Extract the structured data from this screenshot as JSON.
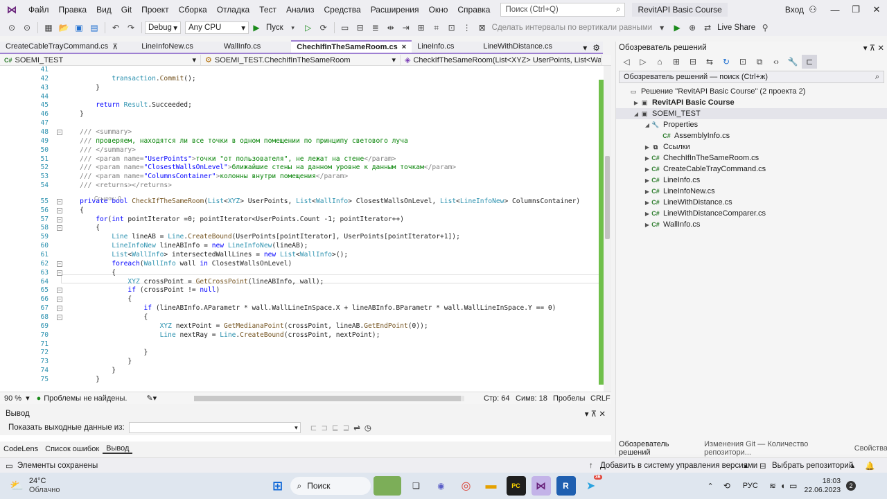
{
  "menu": {
    "items": [
      "Файл",
      "Правка",
      "Вид",
      "Git",
      "Проект",
      "Сборка",
      "Отладка",
      "Тест",
      "Анализ",
      "Средства",
      "Расширения",
      "Окно",
      "Справка"
    ],
    "search_placeholder": "Поиск (Ctrl+Q)",
    "project_name": "RevitAPI Basic Course",
    "login": "Вход"
  },
  "toolbar": {
    "config": "Debug",
    "platform": "Any CPU",
    "run_label": "Пуск",
    "align_label": "Сделать интервалы по вертикали равными",
    "live_share": "Live Share"
  },
  "tabs": [
    {
      "label": "CreateCableTrayCommand.cs",
      "pinned": true,
      "active": false
    },
    {
      "label": "LineInfoNew.cs",
      "active": false
    },
    {
      "label": "WallInfo.cs",
      "active": false
    },
    {
      "label": "ChechIfInTheSameRoom.cs",
      "active": true,
      "close": "×"
    },
    {
      "label": "LineInfo.cs",
      "active": false
    },
    {
      "label": "LineWithDistance.cs",
      "active": false
    }
  ],
  "navbar": {
    "project": "SOEMI_TEST",
    "class": "SOEMI_TEST.ChechIfInTheSameRoom",
    "member": "CheckIfTheSameRoom(List<XYZ> UserPoints, List<WallInfo"
  },
  "code": {
    "references": "Ссылок: 0",
    "lines": [
      {
        "n": "41",
        "html": ""
      },
      {
        "n": "42",
        "html": "            <span class='ty'>transaction</span>.<span class='mt'>Commit</span>();"
      },
      {
        "n": "43",
        "html": "        }"
      },
      {
        "n": "44",
        "html": ""
      },
      {
        "n": "45",
        "html": "        <span class='kw'>return</span> <span class='ty'>Result</span>.Succeeded;"
      },
      {
        "n": "46",
        "html": "    }"
      },
      {
        "n": "47",
        "html": ""
      },
      {
        "n": "48",
        "html": "    <span class='cmx'>///</span> <span class='cmx'>&lt;summary&gt;</span>"
      },
      {
        "n": "49",
        "html": "    <span class='cmx'>///</span> <span class='cm'>проверяем, находятся ли все точки в одном помещении по принципу светового луча</span>"
      },
      {
        "n": "50",
        "html": "    <span class='cmx'>/// &lt;/summary&gt;</span>"
      },
      {
        "n": "51",
        "html": "    <span class='cmx'>/// &lt;param name=</span><span class='kw'>\"UserPoints\"</span><span class='cmx'>&gt;</span><span class='cm'>точки \"от пользователя\", не лежат на стене</span><span class='cmx'>&lt;/param&gt;</span>"
      },
      {
        "n": "52",
        "html": "    <span class='cmx'>/// &lt;param name=</span><span class='kw'>\"ClosestWallsOnLevel\"</span><span class='cmx'>&gt;</span><span class='cm'>ближайшие стены на данном уровне к данным точкам</span><span class='cmx'>&lt;/param&gt;</span>"
      },
      {
        "n": "53",
        "html": "    <span class='cmx'>/// &lt;param name=</span><span class='kw'>\"ColumnsContainer\"</span><span class='cmx'>&gt;</span><span class='cm'>колонны внутри помещения</span><span class='cmx'>&lt;/param&gt;</span>"
      },
      {
        "n": "54",
        "html": "    <span class='cmx'>/// &lt;returns&gt;&lt;/returns&gt;</span>"
      },
      {
        "n": "55",
        "html": "    <span class='kw'>private</span> <span class='kw'>bool</span> <span class='mt'>CheckIfTheSameRoom</span>(<span class='ty'>List</span>&lt;<span class='ty'>XYZ</span>&gt; UserPoints, <span class='ty'>List</span>&lt;<span class='ty'>WallInfo</span>&gt; ClosestWallsOnLevel, <span class='ty'>List</span>&lt;<span class='ty'>LineInfoNew</span>&gt; ColumnsContainer)"
      },
      {
        "n": "56",
        "html": "    {"
      },
      {
        "n": "57",
        "html": "        <span class='kw'>for</span>(<span class='kw'>int</span> pointIterator =0; pointIterator&lt;UserPoints.Count -1; pointIterator++)"
      },
      {
        "n": "58",
        "html": "        {"
      },
      {
        "n": "59",
        "html": "            <span class='ty'>Line</span> lineAB = <span class='ty'>Line</span>.<span class='mt'>CreateBound</span>(UserPoints[pointIterator], UserPoints[pointIterator+1]);"
      },
      {
        "n": "60",
        "html": "            <span class='ty'>LineInfoNew</span> lineABInfo = <span class='kw'>new</span> <span class='ty'>LineInfoNew</span>(lineAB);"
      },
      {
        "n": "61",
        "html": "            <span class='ty'>List</span>&lt;<span class='ty'>WallInfo</span>&gt; intersectedWallLines = <span class='kw'>new</span> <span class='ty'>List</span>&lt;<span class='ty'>WallInfo</span>&gt;();"
      },
      {
        "n": "62",
        "html": "            <span class='kw'>foreach</span>(<span class='ty'>WallInfo</span> wall <span class='kw'>in</span> ClosestWallsOnLevel)"
      },
      {
        "n": "63",
        "html": "            {"
      },
      {
        "n": "64",
        "html": "                <span class='ty'>XYZ</span> crossPoint = <span class='mt'>GetCrossPoint</span>(lineABInfo, wall);"
      },
      {
        "n": "65",
        "html": "                <span class='kw'>if</span> (crossPoint != <span class='kw'>null</span>)"
      },
      {
        "n": "66",
        "html": "                {"
      },
      {
        "n": "67",
        "html": "                    <span class='kw'>if</span> (lineABInfo.AParametr * wall.WallLineInSpace.X + lineABInfo.BParametr * wall.WallLineInSpace.Y == 0)"
      },
      {
        "n": "68",
        "html": "                    {"
      },
      {
        "n": "69",
        "html": "                        <span class='ty'>XYZ</span> nextPoint = <span class='mt'>GetMedianaPoint</span>(crossPoint, lineAB.<span class='mt'>GetEndPoint</span>(0));"
      },
      {
        "n": "70",
        "html": "                        <span class='ty'>Line</span> nextRay = <span class='ty'>Line</span>.<span class='mt'>CreateBound</span>(crossPoint, nextPoint);"
      },
      {
        "n": "71",
        "html": ""
      },
      {
        "n": "72",
        "html": "                    }"
      },
      {
        "n": "73",
        "html": "                }"
      },
      {
        "n": "74",
        "html": "            }"
      },
      {
        "n": "75",
        "html": "        }"
      }
    ]
  },
  "editor_status": {
    "zoom": "90 %",
    "problems": "Проблемы не найдены.",
    "line": "Стр: 64",
    "col": "Симв: 18",
    "tabs": "Пробелы",
    "eol": "CRLF"
  },
  "output": {
    "title": "Вывод",
    "show_from": "Показать выходные данные из:",
    "bottom_tabs": [
      "CodeLens",
      "Список ошибок",
      "Вывод"
    ]
  },
  "solution_explorer": {
    "title": "Обозреватель решений",
    "search": "Обозреватель решений — поиск (Ctrl+ж)",
    "tree": [
      {
        "indent": 0,
        "tri": "",
        "icon": "▭",
        "label": "Решение \"RevitAPI Basic Course\"  (2 проекта 2)",
        "bold": false
      },
      {
        "indent": 1,
        "tri": "▶",
        "icon": "▣",
        "label": "RevitAPI Basic Course",
        "bold": true
      },
      {
        "indent": 1,
        "tri": "◢",
        "icon": "▣",
        "label": "SOEMI_TEST",
        "bold": false,
        "sel": true
      },
      {
        "indent": 2,
        "tri": "◢",
        "icon": "🔧",
        "label": "Properties",
        "bold": false
      },
      {
        "indent": 3,
        "tri": "",
        "icon": "C#",
        "label": "AssemblyInfo.cs",
        "bold": false
      },
      {
        "indent": 2,
        "tri": "▶",
        "icon": "⧉",
        "label": "Ссылки",
        "bold": false
      },
      {
        "indent": 2,
        "tri": "▶",
        "icon": "C#",
        "label": "ChechIfInTheSameRoom.cs",
        "bold": false
      },
      {
        "indent": 2,
        "tri": "▶",
        "icon": "C#",
        "label": "CreateCableTrayCommand.cs",
        "bold": false
      },
      {
        "indent": 2,
        "tri": "▶",
        "icon": "C#",
        "label": "LineInfo.cs",
        "bold": false
      },
      {
        "indent": 2,
        "tri": "▶",
        "icon": "C#",
        "label": "LineInfoNew.cs",
        "bold": false
      },
      {
        "indent": 2,
        "tri": "▶",
        "icon": "C#",
        "label": "LineWithDistance.cs",
        "bold": false
      },
      {
        "indent": 2,
        "tri": "▶",
        "icon": "C#",
        "label": "LineWithDistanceComparer.cs",
        "bold": false
      },
      {
        "indent": 2,
        "tri": "▶",
        "icon": "C#",
        "label": "WallInfo.cs",
        "bold": false
      }
    ],
    "bottom_tabs": [
      "Обозреватель решений",
      "Изменения Git — Количество репозитори...",
      "Свойства"
    ]
  },
  "status_bar": {
    "saved": "Элементы сохранены",
    "add_vcs": "Добавить в систему управления версиями",
    "repo": "Выбрать репозиторий"
  },
  "taskbar": {
    "temp": "24°C",
    "weather": "Облачно",
    "search": "Поиск",
    "lang": "РУС",
    "time": "18:03",
    "date": "22.06.2023",
    "notif_count": "2",
    "telegram_badge": "36"
  }
}
